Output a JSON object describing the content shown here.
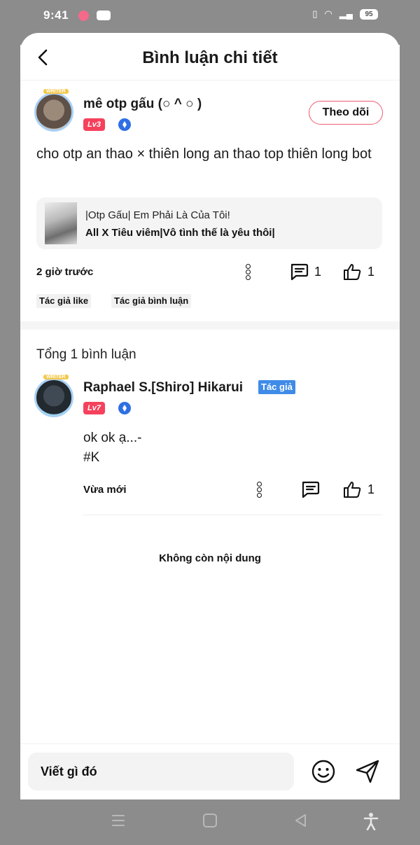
{
  "status_bar": {
    "time": "9:41",
    "battery": "95"
  },
  "header": {
    "title": "Bình luận chi tiết"
  },
  "main_comment": {
    "avatar_badge": "WRITER",
    "user_name": "mê otp gấu (○ ^ ○ )",
    "level": "Lv3",
    "follow_label": "Theo dõi",
    "text": "cho otp an thao × thiên long an thao top thiên long bot",
    "story": {
      "title": "|Otp Gấu| Em Phải Là Của Tôi!",
      "subtitle": "All X Tiêu viêm|Vô tình thế là yêu thôi|"
    },
    "time": "2 giờ trước",
    "comment_count": "1",
    "like_count": "1",
    "tags": [
      "Tác giả like",
      "Tác giả bình luận"
    ]
  },
  "replies_section": {
    "total_label": "Tổng 1 bình luận",
    "replies": [
      {
        "avatar_badge": "WRITER",
        "user_name": "Raphael S.[Shiro] Hikarui",
        "author_tag": "Tác giả",
        "level": "Lv7",
        "line1": "ok ok ạ...-",
        "line2": "#K",
        "time": "Vừa mới",
        "like_count": "1"
      }
    ],
    "end_label": "Không còn nội dung"
  },
  "composer": {
    "placeholder": "Viết gì đó"
  },
  "colors": {
    "accent_red": "#f6415c",
    "author_blue": "#3f8be8",
    "chrome_gray": "#8c8c8c"
  }
}
